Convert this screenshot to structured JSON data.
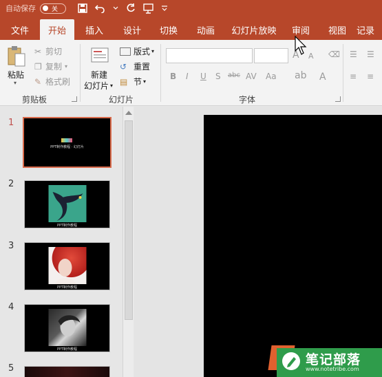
{
  "titlebar": {
    "autosave_label": "自动保存",
    "toggle_state": "关"
  },
  "tabs": [
    {
      "label": "文件"
    },
    {
      "label": "开始",
      "active": true
    },
    {
      "label": "插入"
    },
    {
      "label": "设计"
    },
    {
      "label": "切换"
    },
    {
      "label": "动画"
    },
    {
      "label": "幻灯片放映"
    },
    {
      "label": "审阅"
    },
    {
      "label": "视图"
    },
    {
      "label": "记录"
    }
  ],
  "ribbon": {
    "clipboard": {
      "paste": "粘贴",
      "cut": "剪切",
      "copy": "复制",
      "format_painter": "格式刷",
      "group_label": "剪贴板"
    },
    "slides": {
      "new_slide_line1": "新建",
      "new_slide_line2": "幻灯片",
      "layout": "版式",
      "reset": "重置",
      "section": "节",
      "group_label": "幻灯片"
    },
    "font": {
      "group_label": "字体",
      "bold": "B",
      "italic": "I",
      "underline": "U",
      "shadow": "S",
      "strike": "abc",
      "spacing": "AV",
      "case": "Aa",
      "grow": "A",
      "shrink": "A"
    }
  },
  "slides": [
    {
      "number": "1",
      "selected": true,
      "caption": "PPT制作教程 · 幻灯片"
    },
    {
      "number": "2",
      "caption": "PPT制作教程"
    },
    {
      "number": "3",
      "caption": "PPT制作教程"
    },
    {
      "number": "4",
      "caption": "PPT制作教程"
    },
    {
      "number": "5"
    }
  ],
  "watermark": {
    "title": "笔记部落",
    "url": "www.notetribe.com"
  },
  "colors": {
    "accent": "#b7472a",
    "selection": "#d9694a",
    "watermark_green": "#2f9c4b",
    "watermark_orange": "#e0612f"
  },
  "icons": {
    "save": "save-icon",
    "undo": "undo-icon",
    "redo": "redo-icon",
    "present": "present-icon",
    "more": "more-icon"
  }
}
